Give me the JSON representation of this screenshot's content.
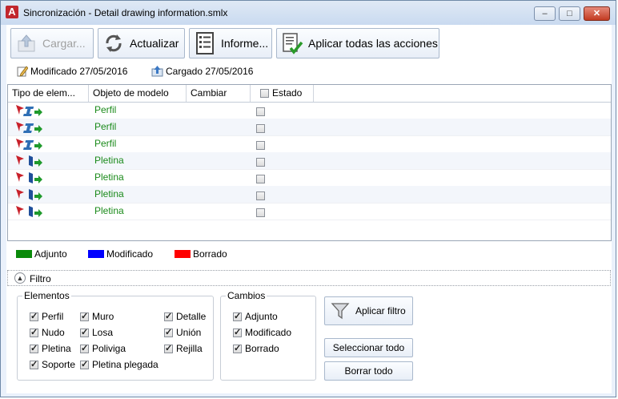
{
  "window": {
    "title": "Sincronización - Detail drawing information.smlx",
    "app_icon_letter": "A",
    "controls": {
      "minimize": "–",
      "maximize": "□",
      "close": "✕"
    }
  },
  "toolbar": {
    "load_label": "Cargar...",
    "refresh_label": "Actualizar",
    "report_label": "Informe...",
    "apply_all_label": "Aplicar todas las acciones"
  },
  "info": {
    "modified": "Modificado 27/05/2016",
    "loaded": "Cargado 27/05/2016"
  },
  "table": {
    "columns": [
      "Tipo de elem...",
      "Objeto de modelo",
      "Cambiar",
      "Estado"
    ],
    "rows": [
      {
        "object": "Perfil",
        "kind": "profile"
      },
      {
        "object": "Perfil",
        "kind": "profile"
      },
      {
        "object": "Perfil",
        "kind": "profile"
      },
      {
        "object": "Pletina",
        "kind": "plate"
      },
      {
        "object": "Pletina",
        "kind": "plate"
      },
      {
        "object": "Pletina",
        "kind": "plate"
      },
      {
        "object": "Pletina",
        "kind": "plate"
      }
    ]
  },
  "legend": [
    {
      "label": "Adjunto",
      "color": "#0a8a0a"
    },
    {
      "label": "Modificado",
      "color": "#0000ff"
    },
    {
      "label": "Borrado",
      "color": "#ff0000"
    }
  ],
  "filter": {
    "title": "Filtro",
    "elements_title": "Elementos",
    "elements": [
      "Perfil",
      "Nudo",
      "Pletina",
      "Soporte",
      "Muro",
      "Losa",
      "Poliviga",
      "Pletina plegada",
      "Detalle",
      "Unión",
      "Rejilla"
    ],
    "changes_title": "Cambios",
    "changes": [
      "Adjunto",
      "Modificado",
      "Borrado"
    ],
    "apply_filter_label": "Aplicar filtro",
    "select_all_label": "Seleccionar todo",
    "clear_all_label": "Borrar todo"
  }
}
